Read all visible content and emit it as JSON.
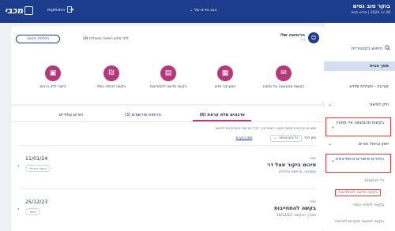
{
  "header": {
    "greeting": "בוקר טוב נסים",
    "date": "28 יוני 2024 | חודש תמוז",
    "account_label": "הצג מדים של",
    "logout_label": "התנתקות",
    "logo_text": "מכבי",
    "logo_icon": "maccabi-logo-square"
  },
  "sidebar": {
    "search_label": "חיפוש בקטגוריות",
    "items": [
      {
        "label": "מסך הבית",
        "chev": ""
      },
      {
        "label": "קורונה - פעולות ומידע",
        "chev": ""
      },
      {
        "label": "תיק לפיאור",
        "chev": "⌄"
      },
      {
        "label": "בקשות מהמעשה אל מחוניו",
        "chev": "⌄"
      },
      {
        "label": "זימון וביטול תורים",
        "chev": "⌄"
      },
      {
        "label": "החזרים אישורים והתחייבויות",
        "chev": "⌃"
      }
    ],
    "subitems": [
      "כל הבקשות",
      "בקשה חדשה להתחייבות",
      "בקשה להחזר כספי",
      "בקשה לאישור מקורים לתרופה"
    ]
  },
  "profile": {
    "name": "הרופאה שלי",
    "role": "דר'",
    "avatar_icon": "user-headset-icon"
  },
  "buttons": {
    "switch_member": "החלפת רופאה",
    "doctor_info": "לדף מידע רופאה באנגלית EN"
  },
  "actions": [
    {
      "label": "בקשות מהמעשה אל מחוניו",
      "icon": "chat-icon"
    },
    {
      "label": "זימון תור חדש",
      "icon": "calendar-icon"
    },
    {
      "label": "בקשה חדשה להתחייבות",
      "icon": "document-icon"
    },
    {
      "label": "בקשה להחזר כספי",
      "icon": "refund-icon"
    },
    {
      "label": "ביקור ללא כרטיס",
      "icon": "card-icon"
    }
  ],
  "tabs": [
    {
      "label": "עדכונים שלא קראת (6)"
    },
    {
      "label": "תרופות ומרשמים (3)"
    },
    {
      "label": "תורים עתידיים"
    }
  ],
  "feed": {
    "info": "מוצגים עדכונים מחצי השנה האחרונה. לכל הודעות והעדכונים לאישור",
    "filter_label": "מיון לפי:",
    "filter_value": "כל העדכונים",
    "sort_link": "סמן כנקרא",
    "rows": [
      {
        "type": "טפס",
        "title": "סיכום ביקור אצל דר",
        "sub": "משפחה, מרפאת ונולולית",
        "date": "11/01/24",
        "badge": "ביקור דיגיטלי"
      },
      {
        "type": "טפס",
        "title": "בקשה להתחייבות",
        "sub": "תאריך הבקשה: 10/12/23",
        "date": "25/12/23",
        "badge": "אושר"
      }
    ]
  },
  "colors": {
    "brand": "#1c3d8c",
    "accent": "#b4387a",
    "highlight": "#e23a3a"
  }
}
